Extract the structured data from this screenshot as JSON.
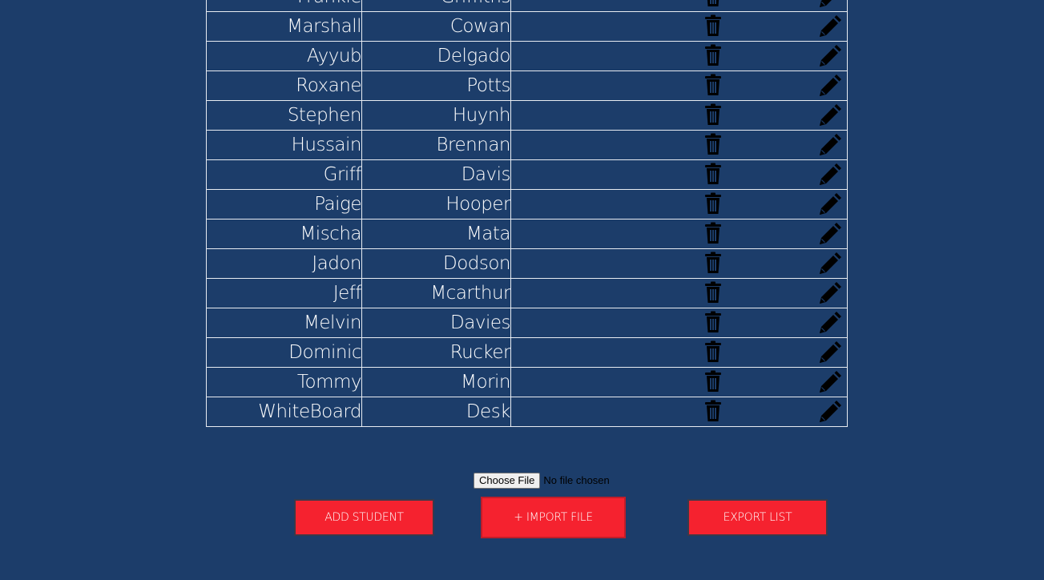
{
  "students": [
    {
      "first": "Frankie",
      "last": "Griffiths"
    },
    {
      "first": "Marshall",
      "last": "Cowan"
    },
    {
      "first": "Ayyub",
      "last": "Delgado"
    },
    {
      "first": "Roxane",
      "last": "Potts"
    },
    {
      "first": "Stephen",
      "last": "Huynh"
    },
    {
      "first": "Hussain",
      "last": "Brennan"
    },
    {
      "first": "Griff",
      "last": "Davis"
    },
    {
      "first": "Paige",
      "last": "Hooper"
    },
    {
      "first": "Mischa",
      "last": "Mata"
    },
    {
      "first": "Jadon",
      "last": "Dodson"
    },
    {
      "first": "Jeff",
      "last": "Mcarthur"
    },
    {
      "first": "Melvin",
      "last": "Davies"
    },
    {
      "first": "Dominic",
      "last": "Rucker"
    },
    {
      "first": "Tommy",
      "last": "Morin"
    },
    {
      "first": "WhiteBoard",
      "last": "Desk"
    }
  ],
  "row_icons": {
    "delete": "trash-icon",
    "edit": "pencil-icon"
  },
  "file_input": {
    "button_label": "Choose File",
    "status": "No file chosen"
  },
  "buttons": {
    "add_student": "ADD STUDENT",
    "import_file": "+ IMPORT FILE",
    "export_list": "EXPORT LIST"
  },
  "colors": {
    "background": "#1c3d6a",
    "button": "#f5222f",
    "table_border": "#e8ecf2",
    "text": "#ffffff",
    "icon": "#000000"
  }
}
